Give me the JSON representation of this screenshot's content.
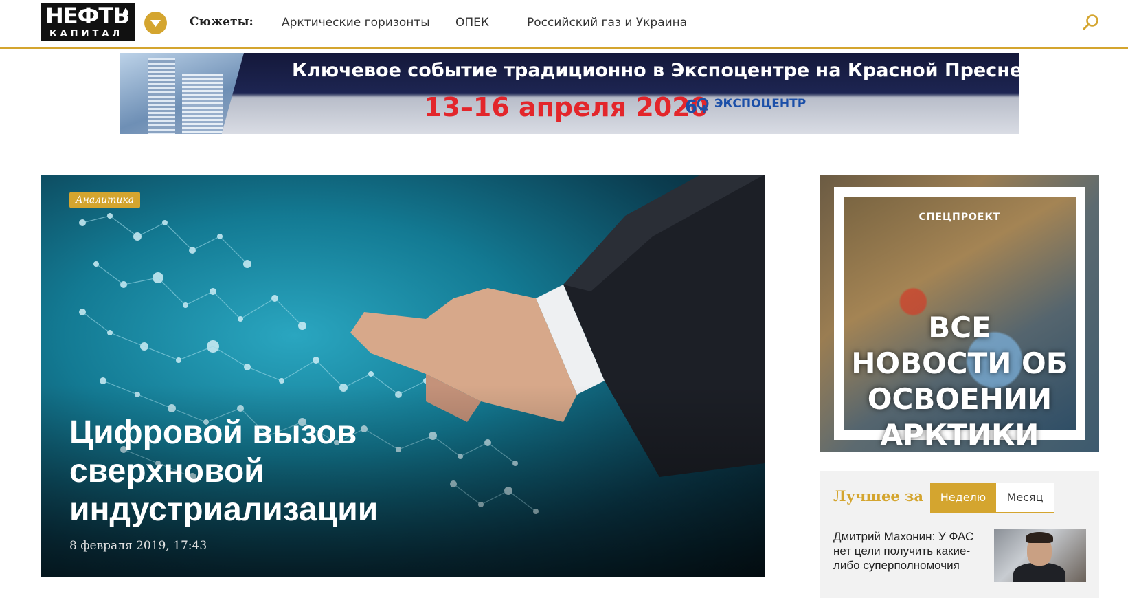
{
  "header": {
    "logo_main": "НЕФТЬ",
    "logo_sub": "КАПИТАЛ",
    "topics_label": "Сюжеты:",
    "topics": [
      {
        "label": "Арктические горизонты"
      },
      {
        "label": "ОПЕК"
      },
      {
        "label": "Российский газ и Украина"
      }
    ],
    "icons": {
      "menu": "chevron-down-icon",
      "search": "search-icon"
    }
  },
  "banner": {
    "line1": "Ключевое событие традиционно в Экспоцентре на Красной Пресне",
    "dates": "13–16 апреля 2020",
    "logo_text": "ЭКСПОЦЕНТР",
    "building_sign": "ЭКСПОЦЕНТР"
  },
  "hero": {
    "tag": "Аналитика",
    "title": "Цифровой вызов сверхновой индустриализации",
    "date": "8 февраля 2019, 17:43"
  },
  "special": {
    "label": "СПЕЦПРОЕКТ",
    "text": "ВСЕ НОВОСТИ ОБ ОСВОЕНИИ АРКТИКИ"
  },
  "best": {
    "title": "Лучшее за",
    "tabs": [
      {
        "label": "Неделю",
        "active": true
      },
      {
        "label": "Месяц",
        "active": false
      }
    ],
    "items": [
      {
        "title": "Дмитрий Махонин: У ФАС нет цели получить какие-либо суперполномочия"
      }
    ]
  },
  "colors": {
    "accent": "#d4a52f",
    "dates_red": "#e3262b",
    "expo_blue": "#1b4fa8"
  }
}
